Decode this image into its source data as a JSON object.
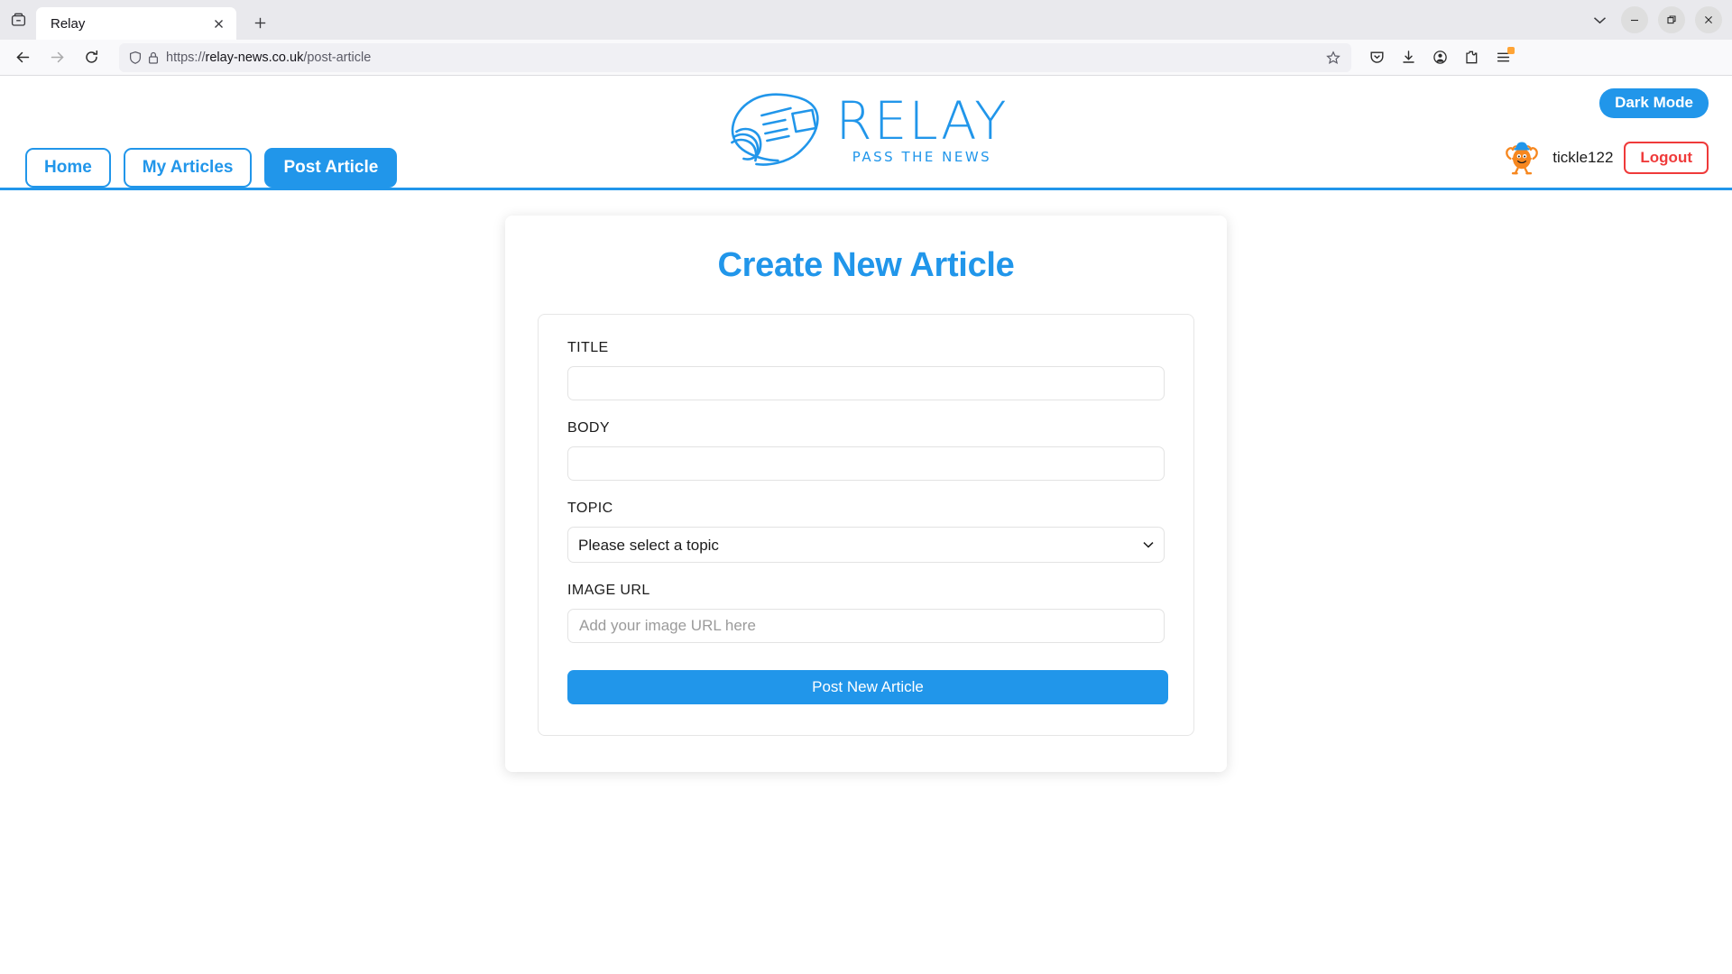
{
  "browser": {
    "tab": {
      "title": "Relay",
      "close_icon": "close-icon",
      "favicon": "container-icon"
    },
    "newtab_icon": "plus-icon",
    "window_controls": {
      "list_tabs_icon": "chevron-down-icon",
      "minimize_icon": "minimize-icon",
      "maximize_icon": "restore-icon",
      "close_icon": "close-icon"
    },
    "nav": {
      "back_icon": "back-arrow-icon",
      "forward_icon": "forward-arrow-icon",
      "reload_icon": "reload-icon"
    },
    "url": {
      "scheme": "https://",
      "host": "relay-news.co.uk",
      "path": "/post-article",
      "full": "https://relay-news.co.uk/post-article",
      "shield_icon": "shield-icon",
      "lock_icon": "lock-icon",
      "bookmark_icon": "star-icon"
    },
    "toolbar_right": [
      {
        "icon": "pocket-icon",
        "label": "Save to Pocket"
      },
      {
        "icon": "download-icon",
        "label": "Downloads"
      },
      {
        "icon": "account-icon",
        "label": "Account"
      },
      {
        "icon": "extensions-icon",
        "label": "Extensions"
      },
      {
        "icon": "menu-icon",
        "label": "Application Menu",
        "badge": true
      }
    ]
  },
  "site": {
    "logo": {
      "wordmark": "RELAY",
      "tagline": "PASS THE NEWS",
      "icon": "rolled-newspaper-icon"
    },
    "dark_mode_label": "Dark Mode",
    "user": {
      "name": "tickle122",
      "avatar_icon": "mr-tickle-avatar"
    },
    "logout_label": "Logout",
    "nav": [
      {
        "label": "Home",
        "active": false
      },
      {
        "label": "My Articles",
        "active": false
      },
      {
        "label": "Post Article",
        "active": true
      }
    ]
  },
  "form": {
    "heading": "Create New Article",
    "title": {
      "label": "TITLE",
      "value": "",
      "placeholder": ""
    },
    "body": {
      "label": "BODY",
      "value": "",
      "placeholder": ""
    },
    "topic": {
      "label": "TOPIC",
      "selected": "Please select a topic",
      "options": [
        "Please select a topic"
      ],
      "chevron_icon": "chevron-down-icon"
    },
    "image_url": {
      "label": "IMAGE URL",
      "value": "",
      "placeholder": "Add your image URL here"
    },
    "submit_label": "Post New Article"
  },
  "colors": {
    "brand_blue": "#2196ea",
    "logout_red": "#ef3a3a",
    "badge_orange": "#ffa436",
    "avatar_orange": "#f6871f"
  }
}
